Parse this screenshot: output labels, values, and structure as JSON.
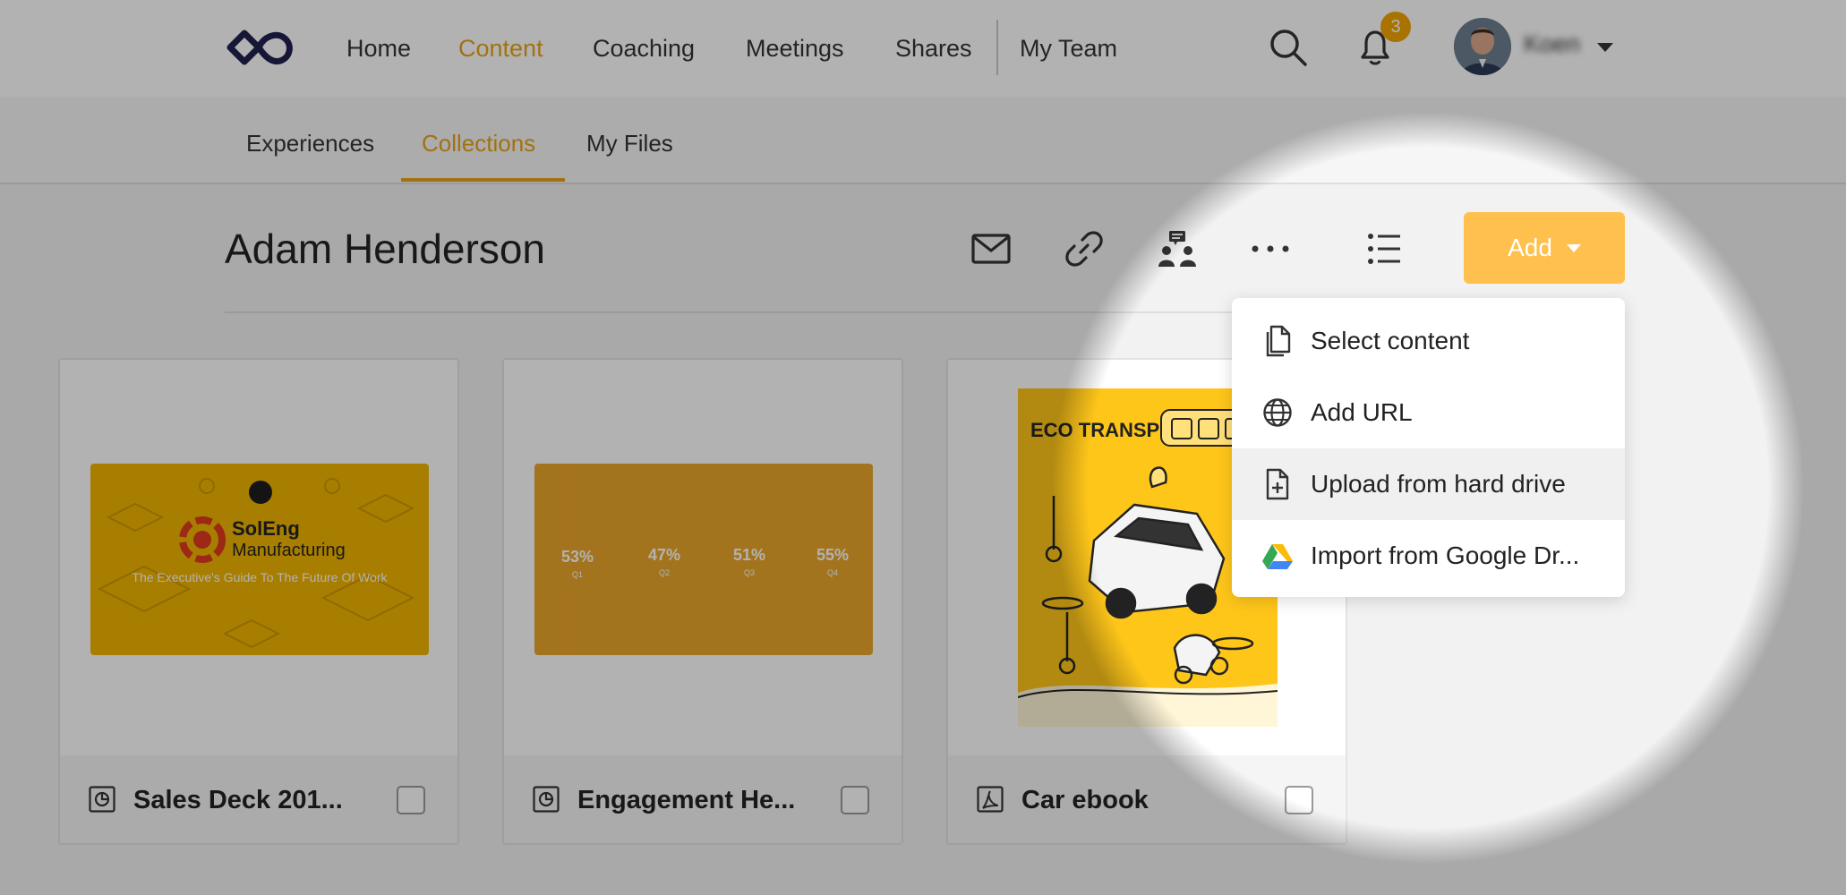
{
  "nav": {
    "items": [
      {
        "label": "Home",
        "active": false
      },
      {
        "label": "Content",
        "active": true
      },
      {
        "label": "Coaching",
        "active": false
      },
      {
        "label": "Meetings",
        "active": false
      },
      {
        "label": "Shares",
        "active": false
      },
      {
        "label": "My Team",
        "active": false
      }
    ],
    "notification_count": "3",
    "user_name": "Koen"
  },
  "subnav": {
    "tabs": [
      {
        "label": "Experiences",
        "active": false
      },
      {
        "label": "Collections",
        "active": true
      },
      {
        "label": "My Files",
        "active": false
      }
    ]
  },
  "page": {
    "title": "Adam Henderson",
    "add_label": "Add"
  },
  "dropdown": {
    "items": [
      {
        "label": "Select content",
        "icon": "document-icon"
      },
      {
        "label": "Add URL",
        "icon": "globe-icon"
      },
      {
        "label": "Upload from hard drive",
        "icon": "file-upload-icon"
      },
      {
        "label": "Import from Google Dr...",
        "icon": "google-drive-icon"
      }
    ]
  },
  "cards": [
    {
      "title": "Sales Deck 201...",
      "type_icon": "presentation-icon",
      "thumb": {
        "brand": "SolEng",
        "subbrand": "Manufacturing",
        "tagline": "The Executive's Guide To The Future Of Work"
      }
    },
    {
      "title": "Engagement He...",
      "type_icon": "presentation-icon",
      "thumb": {
        "stats": [
          {
            "value": "53%",
            "label": "Q1"
          },
          {
            "value": "47%",
            "label": "Q2"
          },
          {
            "value": "51%",
            "label": "Q3"
          },
          {
            "value": "55%",
            "label": "Q4"
          }
        ]
      }
    },
    {
      "title": "Car ebook",
      "type_icon": "pdf-icon",
      "thumb": {
        "heading": "ECO TRANSPORT"
      }
    }
  ],
  "colors": {
    "accent": "#e8a317",
    "add_button": "#ffc04d",
    "badge": "#f0a500",
    "logo": "#1f1f4f"
  }
}
